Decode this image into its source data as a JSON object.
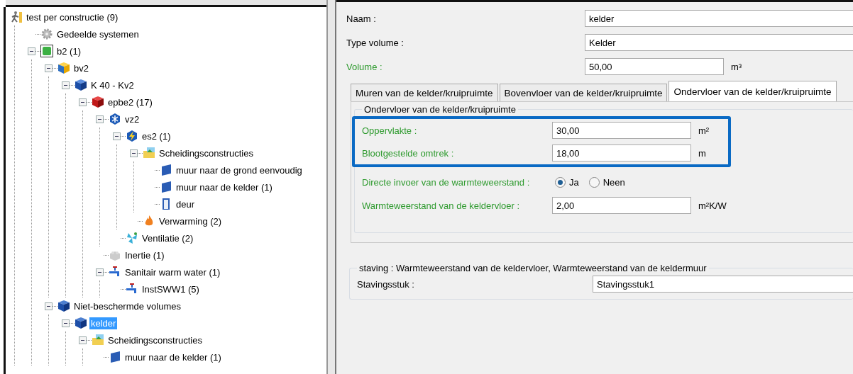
{
  "tree": [
    {
      "label": "test per constructie (9)",
      "kind": "person",
      "selected": false,
      "children": [
        {
          "label": "Gedeelde systemen",
          "kind": "gear",
          "selected": false
        },
        {
          "label": "b2 (1)",
          "kind": "green-cube",
          "selected": false,
          "expanded": true,
          "children": [
            {
              "label": "bv2",
              "kind": "yellow-cube",
              "selected": false,
              "expanded": true,
              "children": [
                {
                  "label": "K 40 - Kv2",
                  "kind": "blue-k",
                  "selected": false,
                  "expanded": true,
                  "children": [
                    {
                      "label": "epbe2 (17)",
                      "kind": "red-cube",
                      "selected": false,
                      "expanded": true,
                      "children": [
                        {
                          "label": "vz2",
                          "kind": "snow",
                          "selected": false,
                          "expanded": true,
                          "children": [
                            {
                              "label": "es2 (1)",
                              "kind": "bolt",
                              "selected": false,
                              "expanded": true,
                              "children": [
                                {
                                  "label": "Scheidingsconstructies",
                                  "kind": "folder",
                                  "selected": false,
                                  "expanded": true,
                                  "children": [
                                    {
                                      "label": "muur naar de grond eenvoudig",
                                      "kind": "wall",
                                      "selected": false
                                    },
                                    {
                                      "label": "muur naar de kelder (1)",
                                      "kind": "wall",
                                      "selected": false
                                    },
                                    {
                                      "label": "deur",
                                      "kind": "door",
                                      "selected": false
                                    }
                                  ]
                                },
                                {
                                  "label": "Verwarming (2)",
                                  "kind": "flame",
                                  "selected": false
                                }
                              ]
                            },
                            {
                              "label": "Ventilatie (2)",
                              "kind": "fan",
                              "selected": false
                            }
                          ]
                        },
                        {
                          "label": "Inertie (1)",
                          "kind": "brick",
                          "selected": false
                        },
                        {
                          "label": "Sanitair warm water (1)",
                          "kind": "tap",
                          "selected": false,
                          "expanded": true,
                          "children": [
                            {
                              "label": "InstSWW1 (5)",
                              "kind": "tap",
                              "selected": false
                            }
                          ]
                        }
                      ]
                    }
                  ]
                }
              ]
            },
            {
              "label": "Niet-beschermde volumes",
              "kind": "blue-cube",
              "selected": false,
              "expanded": true,
              "children": [
                {
                  "label": "kelder",
                  "kind": "blue-cube",
                  "selected": true,
                  "expanded": true,
                  "children": [
                    {
                      "label": "Scheidingsconstructies",
                      "kind": "folder",
                      "selected": false,
                      "expanded": true,
                      "children": [
                        {
                          "label": "muur naar de kelder (1)",
                          "kind": "wall",
                          "selected": false
                        }
                      ]
                    }
                  ]
                }
              ]
            }
          ]
        }
      ]
    }
  ],
  "form": [
    {
      "label": "Naam :",
      "value": "kelder",
      "color": "#000000"
    },
    {
      "label": "Type volume :",
      "value": "Kelder",
      "color": "#000000"
    },
    {
      "label": "Volume :",
      "value": "50,00",
      "unit": "m³",
      "color": "#2e9a2e"
    }
  ],
  "tabs": [
    {
      "label": "Muren van de kelder/kruipruimte",
      "selected": false
    },
    {
      "label": "Bovenvloer van de kelder/kruipruimte",
      "selected": false
    },
    {
      "label": "Ondervloer van de kelder/kruipruimte",
      "selected": true
    }
  ],
  "tab_panel": {
    "legend": "Ondervloer van de kelder/kruipruimte",
    "highlighted_fields": [
      {
        "label": "Oppervlakte :",
        "value": "30,00",
        "unit": "m²"
      },
      {
        "label": "Blootgestelde omtrek :",
        "value": "18,00",
        "unit": "m"
      }
    ],
    "radio": {
      "label": "Directe invoer van de warmteweerstand :",
      "options": [
        {
          "label": "Ja",
          "selected": true
        },
        {
          "label": "Neen",
          "selected": false
        }
      ]
    },
    "fields": [
      {
        "label": "Warmteweerstand van de keldervloer :",
        "value": "2,00",
        "unit": "m²K/W"
      }
    ]
  },
  "staving": {
    "legend": "staving : Warmteweerstand van de keldervloer, Warmteweerstand van de keldermuur",
    "label": "Stavingsstuk :",
    "value": "Stavingsstuk1"
  }
}
